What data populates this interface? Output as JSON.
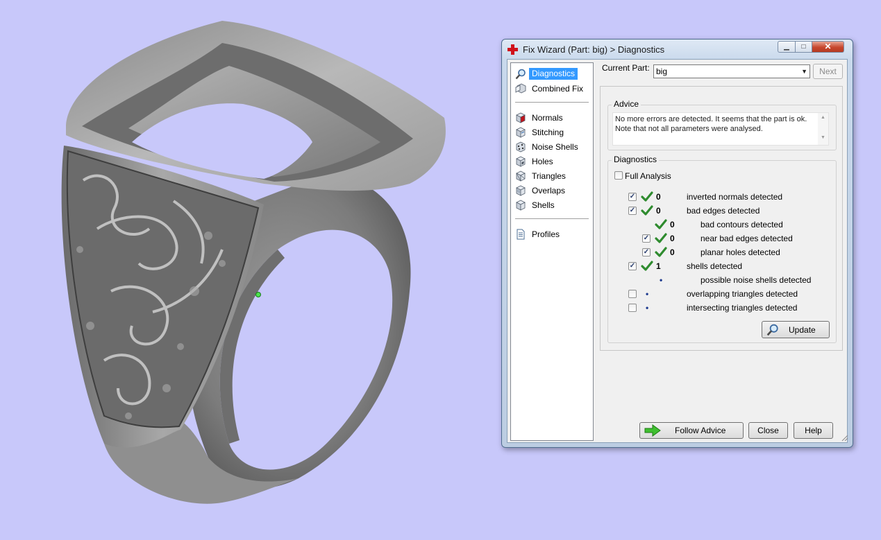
{
  "window": {
    "title": "Fix Wizard (Part: big) > Diagnostics"
  },
  "nav": {
    "items": [
      {
        "label": "Diagnostics",
        "icon": "magnifier-icon",
        "selected": true
      },
      {
        "label": "Combined Fix",
        "icon": "combined-fix-icon"
      },
      {
        "label": "Normals",
        "icon": "normals-cube-icon"
      },
      {
        "label": "Stitching",
        "icon": "stitching-cube-icon"
      },
      {
        "label": "Noise Shells",
        "icon": "noise-shells-icon"
      },
      {
        "label": "Holes",
        "icon": "holes-cube-icon"
      },
      {
        "label": "Triangles",
        "icon": "triangles-cube-icon"
      },
      {
        "label": "Overlaps",
        "icon": "overlaps-cube-icon"
      },
      {
        "label": "Shells",
        "icon": "shells-cube-icon"
      },
      {
        "label": "Profiles",
        "icon": "profile-document-icon"
      }
    ]
  },
  "current_part": {
    "label": "Current Part:",
    "value": "big"
  },
  "next_label": "Next",
  "advice": {
    "title": "Advice",
    "text": "No more errors are detected. It seems that the part is ok.\nNote that not all parameters were analysed."
  },
  "diagnostics": {
    "title": "Diagnostics",
    "full_analysis": {
      "label": "Full Analysis",
      "checked": false
    },
    "rows": [
      {
        "checkbox": true,
        "checked": true,
        "status": "ok",
        "count": "0",
        "text": "inverted normals detected",
        "indent": 0
      },
      {
        "checkbox": true,
        "checked": true,
        "status": "ok",
        "count": "0",
        "text": "bad edges detected",
        "indent": 0
      },
      {
        "checkbox": false,
        "checked": false,
        "status": "ok",
        "count": "0",
        "text": "bad contours detected",
        "indent": 1
      },
      {
        "checkbox": true,
        "checked": true,
        "status": "ok",
        "count": "0",
        "text": "near bad edges detected",
        "indent": 1
      },
      {
        "checkbox": true,
        "checked": true,
        "status": "ok",
        "count": "0",
        "text": "planar holes detected",
        "indent": 1
      },
      {
        "checkbox": true,
        "checked": true,
        "status": "ok",
        "count": "1",
        "text": "shells detected",
        "indent": 0
      },
      {
        "checkbox": false,
        "checked": false,
        "status": "none",
        "count": "",
        "text": "possible noise shells detected",
        "indent": 1
      },
      {
        "checkbox": true,
        "checked": false,
        "status": "none",
        "count": "",
        "text": "overlapping triangles detected",
        "indent": 0
      },
      {
        "checkbox": true,
        "checked": false,
        "status": "none",
        "count": "",
        "text": "intersecting triangles detected",
        "indent": 0
      }
    ],
    "update_label": "Update"
  },
  "buttons": {
    "follow_advice": "Follow Advice",
    "close": "Close",
    "help": "Help"
  },
  "colors": {
    "background": "#c8c8fa",
    "selection": "#3399ff",
    "check_green": "#2e8b2e",
    "ring": "#8c8c8c"
  }
}
